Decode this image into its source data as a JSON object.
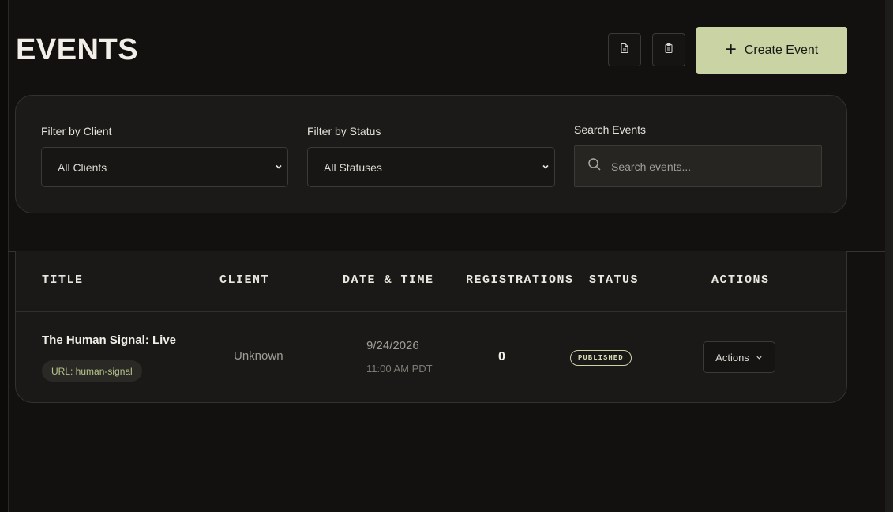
{
  "header": {
    "title": "EVENTS",
    "icon_buttons": [
      {
        "icon": "document-icon"
      },
      {
        "icon": "clipboard-icon"
      }
    ],
    "create_button": {
      "icon": "plus-icon",
      "plus_glyph": "+",
      "label": "Create Event"
    }
  },
  "filters": {
    "client": {
      "label": "Filter by Client",
      "value": "All Clients"
    },
    "status": {
      "label": "Filter by Status",
      "value": "All Statuses"
    },
    "search": {
      "label": "Search Events",
      "placeholder": "Search events...",
      "value": ""
    }
  },
  "table": {
    "columns": [
      "TITLE",
      "CLIENT",
      "DATE & TIME",
      "REGISTRATIONS",
      "STATUS",
      "ACTIONS"
    ],
    "rows": [
      {
        "title": "The Human Signal: Live",
        "url_label": "URL: human-signal",
        "client": "Unknown",
        "date": "9/24/2026",
        "time": "11:00 AM PDT",
        "registrations": "0",
        "status": "PUBLISHED",
        "actions_label": "Actions"
      }
    ]
  },
  "colors": {
    "background": "#121110",
    "panel": "#1b1a18",
    "accent": "#c9d3a3",
    "url_text": "#b8c48c"
  }
}
